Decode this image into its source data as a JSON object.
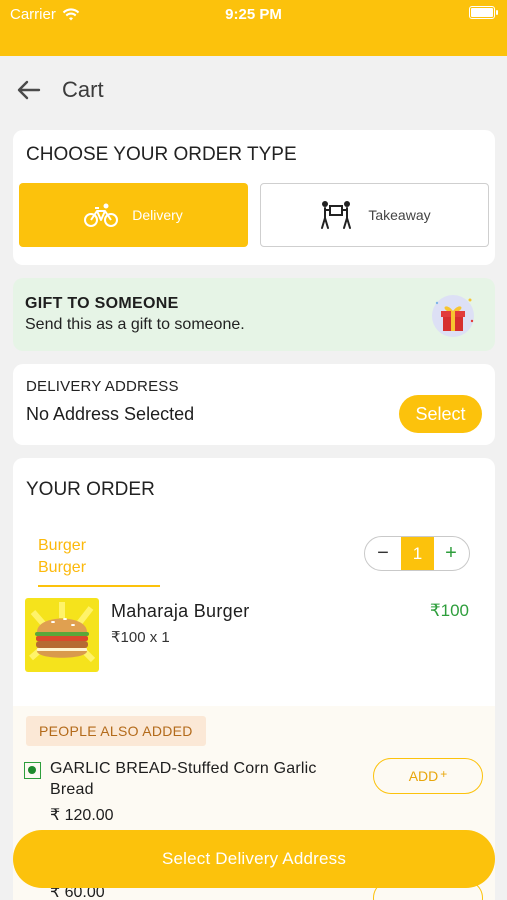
{
  "status_bar": {
    "carrier": "Carrier",
    "time": "9:25 PM"
  },
  "header": {
    "title": "Cart"
  },
  "order_type": {
    "title": "CHOOSE YOUR ORDER TYPE",
    "options": [
      {
        "label": "Delivery",
        "selected": true,
        "icon": "bicycle-icon"
      },
      {
        "label": "Takeaway",
        "selected": false,
        "icon": "takeaway-icon"
      }
    ]
  },
  "gift": {
    "title": "GIFT TO SOMEONE",
    "subtitle": "Send this as a gift to someone.",
    "icon": "gift-icon"
  },
  "delivery_address": {
    "label": "DELIVERY ADDRESS",
    "value": "No Address Selected",
    "button": "Select"
  },
  "your_order": {
    "title": "YOUR ORDER",
    "category_lines": [
      "Burger",
      "Burger"
    ],
    "item": {
      "name": "Maharaja  Burger",
      "unit_price_qty": "₹100 x 1",
      "price": "₹100",
      "quantity": "1"
    }
  },
  "people_also_added": {
    "title": "PEOPLE ALSO ADDED",
    "items": [
      {
        "name": "GARLIC BREAD-Stuffed Corn Garlic Bread",
        "price": "₹ 120.00",
        "button": "ADD",
        "button_sup": "+"
      },
      {
        "price": "₹ 60.00"
      }
    ]
  },
  "footer": {
    "cta": "Select Delivery Address"
  },
  "colors": {
    "accent": "#fcc20c",
    "green": "#2e9e3c",
    "gift_bg": "#e6f4e6"
  }
}
